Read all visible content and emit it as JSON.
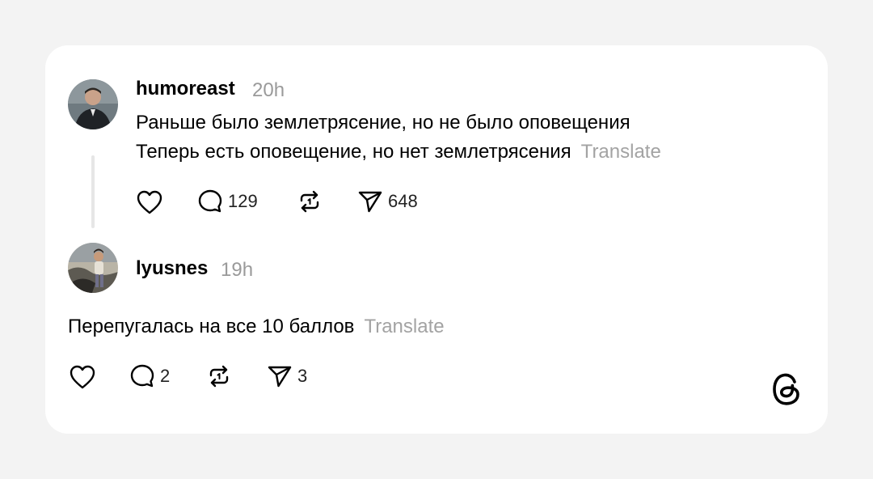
{
  "posts": [
    {
      "username": "humoreast",
      "time": "20h",
      "lines": [
        "Раньше было землетрясение, но не было оповещения",
        "Теперь есть оповещение, но нет землетрясения"
      ],
      "translate_label": "Translate",
      "comments": "129",
      "shares": "648"
    },
    {
      "username": "lyusnes",
      "time": "19h",
      "text": "Перепугалась на все 10 баллов",
      "translate_label": "Translate",
      "comments": "2",
      "shares": "3"
    }
  ],
  "icons": {
    "like": "heart-icon",
    "comment": "comment-icon",
    "repost": "repost-icon",
    "share": "send-icon",
    "brand": "threads-logo"
  }
}
